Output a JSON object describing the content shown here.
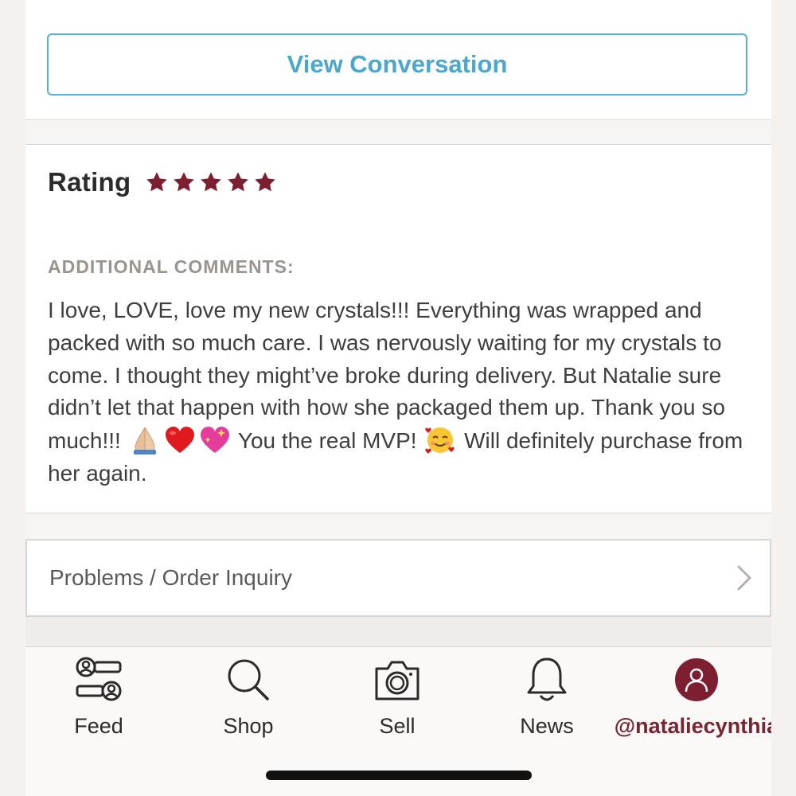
{
  "conversation": {
    "button_label": "View Conversation"
  },
  "rating": {
    "label": "Rating",
    "stars": 5,
    "max_stars": 5,
    "star_color": "#7e1f31"
  },
  "comments": {
    "label": "ADDITIONAL COMMENTS:",
    "text_part1": "I love, LOVE, love my new crystals!!! Everything was wrapped and packed with so much care. I was nervously waiting for my crystals to come. I thought they might’ve broke during delivery. But Natalie sure didn’t let that happen with how she packaged them up. Thank you so much!!! ",
    "text_part2": " You the real MVP! ",
    "text_part3": " Will definitely purchase from her again.",
    "emojis": [
      "praying-hands-emoji",
      "red-heart-emoji",
      "sparkling-heart-emoji",
      "smiling-face-with-hearts-emoji"
    ]
  },
  "inquiry": {
    "label": "Problems / Order Inquiry"
  },
  "tabbar": {
    "feed": "Feed",
    "shop": "Shop",
    "sell": "Sell",
    "news": "News",
    "profile": "@nataliecynthia"
  },
  "colors": {
    "accent_blue": "#4aa7cf",
    "brand_maroon": "#7e1f31"
  }
}
